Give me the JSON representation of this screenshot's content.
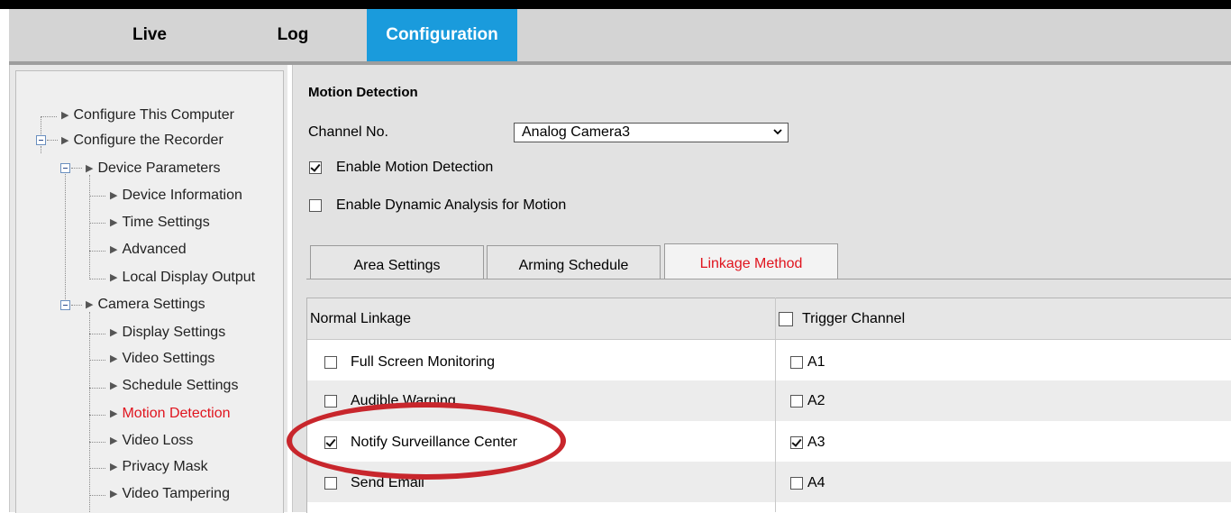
{
  "nav": {
    "items": [
      {
        "label": "Live"
      },
      {
        "label": "Log"
      },
      {
        "label": "Configuration"
      }
    ]
  },
  "sidebar": {
    "items": [
      {
        "label": "Configure This Computer"
      },
      {
        "label": "Configure the Recorder"
      },
      {
        "label": "Device Parameters"
      },
      {
        "label": "Device Information"
      },
      {
        "label": "Time Settings"
      },
      {
        "label": "Advanced"
      },
      {
        "label": "Local Display Output"
      },
      {
        "label": "Camera Settings"
      },
      {
        "label": "Display Settings"
      },
      {
        "label": "Video Settings"
      },
      {
        "label": "Schedule Settings"
      },
      {
        "label": "Motion Detection"
      },
      {
        "label": "Video Loss"
      },
      {
        "label": "Privacy Mask"
      },
      {
        "label": "Video Tampering"
      }
    ]
  },
  "main": {
    "title": "Motion Detection",
    "channel_label": "Channel No.",
    "channel_value": "Analog Camera3",
    "enable_motion_label": "Enable Motion Detection",
    "enable_dynamic_label": "Enable Dynamic Analysis for Motion",
    "tabs": [
      {
        "label": "Area Settings"
      },
      {
        "label": "Arming Schedule"
      },
      {
        "label": "Linkage Method"
      }
    ],
    "table": {
      "col1_header": "Normal Linkage",
      "col2_header": "Trigger Channel",
      "rows": [
        {
          "label": "Full Screen Monitoring",
          "channel": "A1"
        },
        {
          "label": "Audible Warning",
          "channel": "A2"
        },
        {
          "label": "Notify Surveillance Center",
          "channel": "A3"
        },
        {
          "label": "Send Email",
          "channel": "A4"
        }
      ]
    }
  },
  "colors": {
    "accent": "#1a9bdc",
    "active_text": "#e0141e",
    "annotation": "#c8262c"
  }
}
